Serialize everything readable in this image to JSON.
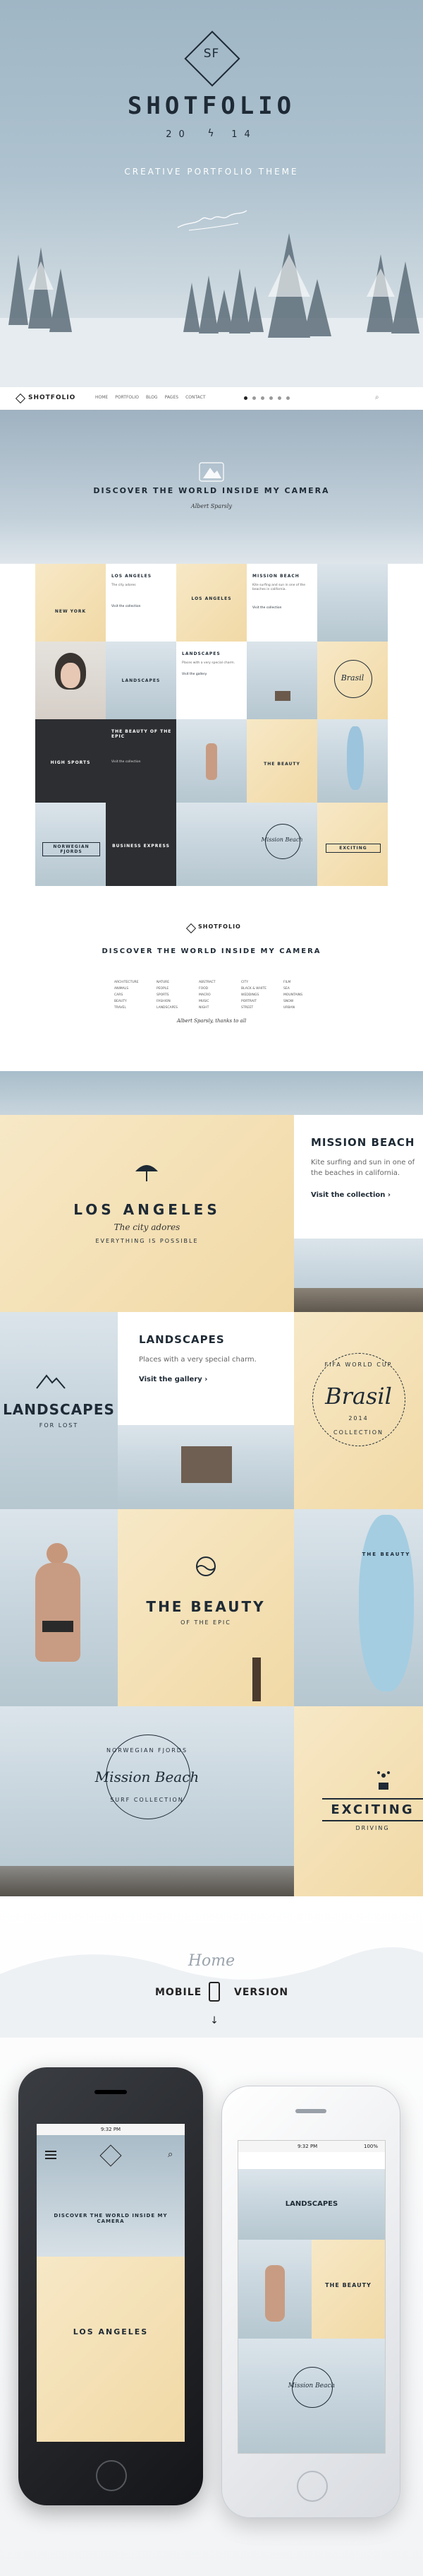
{
  "hero": {
    "logo_mark": "SF",
    "brand": "SHOTFOLIO",
    "year_left": "20",
    "year_right": "14",
    "tagline": "CREATIVE PORTFOLIO THEME"
  },
  "nav": {
    "brand": "SHOTFOLIO",
    "links": [
      "HOME",
      "PORTFOLIO",
      "BLOG",
      "PAGES",
      "CONTACT"
    ]
  },
  "banner": {
    "title": "DISCOVER THE WORLD INSIDE MY CAMERA",
    "signature": "Albert Sparsly"
  },
  "small_grid": {
    "newyork": "NEW YORK",
    "la_title": "LOS ANGELES",
    "la_caption": "LOS ANGELES",
    "la_sub": "The city adores",
    "mission_caption": "MISSION BEACH",
    "mission_text": "Kite surfing and sun in one of the beaches in california.",
    "visit_collection": "Visit the collection",
    "landscapes": "LANDSCAPES",
    "landscapes_title": "LANDSCAPES",
    "landscapes_text": "Places with a very special charm.",
    "visit_gallery": "Visit the gallery",
    "brasil": "Brasil",
    "highsports": "HIGH SPORTS",
    "beauty_caption": "THE BEAUTY OF THE EPIC",
    "the_beauty": "THE BEAUTY",
    "norwegian": "NORWEGIAN FJORDS",
    "business": "BUSINESS EXPRESS",
    "mission_beach_script": "Mission Beach",
    "exciting": "EXCITING"
  },
  "footer": {
    "brand": "SHOTFOLIO",
    "title": "DISCOVER THE WORLD INSIDE MY CAMERA",
    "columns": [
      [
        "ARCHITECTURE",
        "ANIMALS",
        "CARS",
        "BEAUTY",
        "TRAVEL"
      ],
      [
        "NATURE",
        "PEOPLE",
        "SPORTS",
        "FASHION",
        "LANDSCAPES"
      ],
      [
        "ABSTRACT",
        "FOOD",
        "MACRO",
        "MUSIC",
        "NIGHT"
      ],
      [
        "CITY",
        "BLACK & WHITE",
        "WEDDINGS",
        "PORTRAIT",
        "STREET"
      ],
      [
        "FILM",
        "SEA",
        "MOUNTAINS",
        "SNOW",
        "URBAN"
      ]
    ],
    "signature": "Albert Sparsly, thanks to all"
  },
  "big_grid": {
    "la_title": "LOS ANGELES",
    "la_script": "The city adores",
    "la_sub": "EVERYTHING IS POSSIBLE",
    "mission_title": "MISSION BEACH",
    "mission_text": "Kite surfing and sun in one of the beaches in california.",
    "visit_collection": "Visit the collection",
    "landscapes_badge": "LANDSCAPES",
    "landscapes_sub": "FOR LOST",
    "landscapes_title": "LANDSCAPES",
    "landscapes_text": "Places with a very special charm.",
    "visit_gallery": "Visit the gallery",
    "brasil_top": "FIFA WORLD CUP",
    "brasil_script": "Brasil",
    "brasil_year": "2014",
    "brasil_bottom": "COLLECTION",
    "beauty_title": "THE BEAUTY",
    "beauty_sub": "OF THE EPIC",
    "beauty_board": "THE BEAUTY",
    "mission_badge_top": "NORWEGIAN FJORDS",
    "mission_badge_script": "Mission Beach",
    "mission_badge_bottom": "SURF COLLECTION",
    "exciting_title": "EXCITING",
    "exciting_sub": "DRIVING"
  },
  "mobile": {
    "home_label": "Home",
    "left": "MOBILE",
    "right": "VERSION",
    "time": "9:32 PM",
    "battery": "100%",
    "phone_title": "DISCOVER THE WORLD INSIDE MY CAMERA",
    "la": "LOS ANGELES",
    "landscapes": "LANDSCAPES",
    "beauty": "THE BEAUTY",
    "mission": "Mission Beach"
  },
  "colors": {
    "ink": "#1e2a35",
    "sand": "#f3deb0",
    "sky": "#aec2cf",
    "dark": "#2c2e31"
  }
}
